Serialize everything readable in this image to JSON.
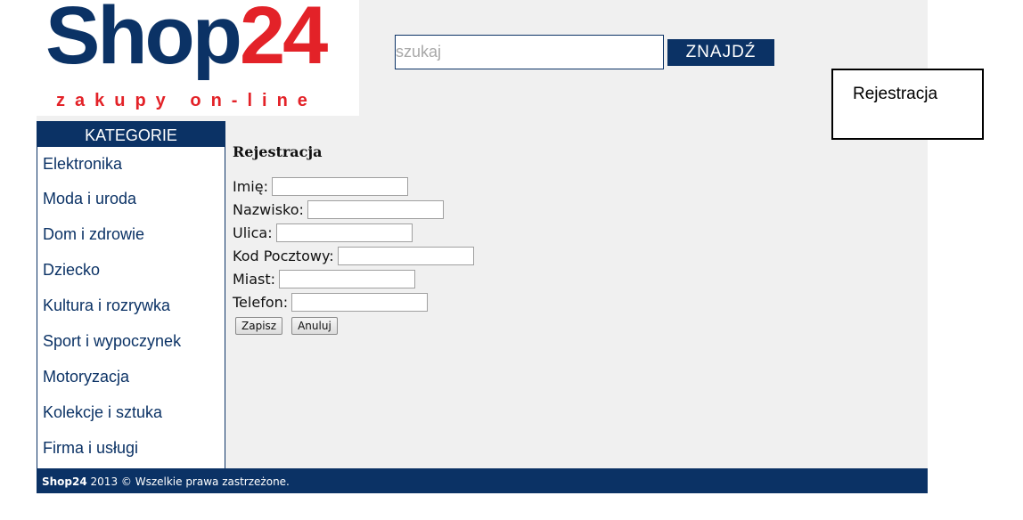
{
  "logo": {
    "brand": "Shop",
    "number": "24",
    "tagline": "zakupy on-line"
  },
  "search": {
    "placeholder": "szukaj",
    "value": "",
    "button_label": "ZNAJDŹ"
  },
  "register_box": {
    "label": "Rejestracja"
  },
  "sidebar": {
    "header": "KATEGORIE",
    "items": [
      {
        "label": "Elektronika"
      },
      {
        "label": "Moda i uroda"
      },
      {
        "label": "Dom i zdrowie"
      },
      {
        "label": "Dziecko"
      },
      {
        "label": "Kultura i rozrywka"
      },
      {
        "label": "Sport i wypoczynek"
      },
      {
        "label": "Motoryzacja"
      },
      {
        "label": "Kolekcje i sztuka"
      },
      {
        "label": "Firma i usługi"
      }
    ]
  },
  "form": {
    "title": "Rejestracja",
    "fields": {
      "first_name": {
        "label": "Imię:",
        "value": ""
      },
      "last_name": {
        "label": "Nazwisko:",
        "value": ""
      },
      "street": {
        "label": "Ulica:",
        "value": ""
      },
      "postal_code": {
        "label": "Kod Pocztowy:",
        "value": ""
      },
      "city": {
        "label": "Miast:",
        "value": ""
      },
      "phone": {
        "label": "Telefon:",
        "value": ""
      }
    },
    "save_label": "Zapisz",
    "cancel_label": "Anuluj"
  },
  "footer": {
    "brand": "Shop24",
    "text": " 2013 © Wszelkie prawa zastrzeżone."
  },
  "colors": {
    "primary": "#0b3265",
    "accent": "#e32228",
    "page_bg": "#f0f0f0"
  }
}
